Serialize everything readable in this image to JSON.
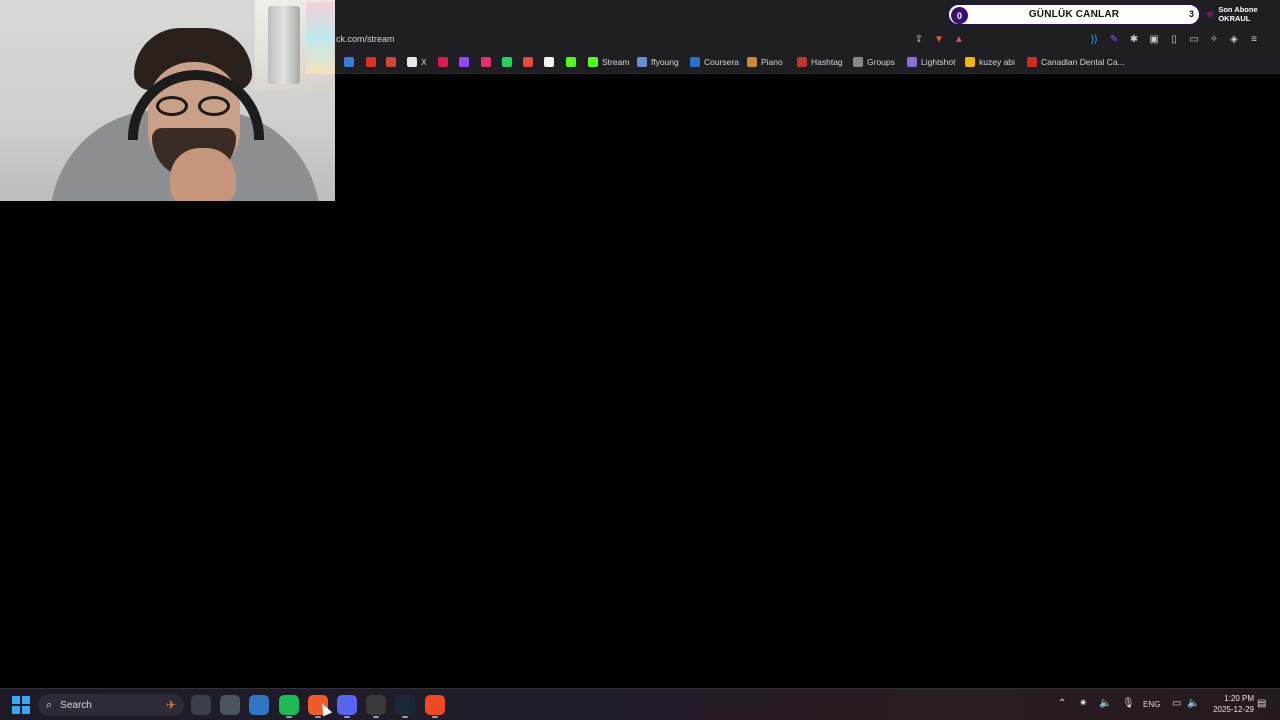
{
  "browser": {
    "url": "ck.com/stream",
    "bookmarks": [
      {
        "label": "",
        "icon": "edge-icon",
        "color": "#3a7bd5"
      },
      {
        "label": "",
        "icon": "youtube-icon",
        "color": "#e52d27"
      },
      {
        "label": "",
        "icon": "gmail-icon",
        "color": "#d44638"
      },
      {
        "label": "X",
        "icon": "x-icon",
        "color": "#e8e8e8"
      },
      {
        "label": "",
        "icon": "opera-icon",
        "color": "#e01a4f"
      },
      {
        "label": "",
        "icon": "twitch-icon",
        "color": "#9146ff"
      },
      {
        "label": "",
        "icon": "instagram-icon",
        "color": "#e1306c"
      },
      {
        "label": "",
        "icon": "whatsapp-icon",
        "color": "#25d366"
      },
      {
        "label": "",
        "icon": "tumblr-icon",
        "color": "#e34c3c"
      },
      {
        "label": "",
        "icon": "amazon-icon",
        "color": "#f2f2f2"
      },
      {
        "label": "",
        "icon": "kick-icon",
        "color": "#53fc18"
      },
      {
        "label": "Stream",
        "icon": "kick-icon",
        "color": "#53fc18"
      },
      {
        "label": "ffyoung",
        "icon": "link-icon",
        "color": "#6a8fd0"
      },
      {
        "label": "Coursera",
        "icon": "coursera-icon",
        "color": "#2a73cc"
      },
      {
        "label": "Piano",
        "icon": "piano-icon",
        "color": "#c98b3c"
      },
      {
        "label": "Hashtag",
        "icon": "hashtag-icon",
        "color": "#c0392b"
      },
      {
        "label": "Groups",
        "icon": "groups-icon",
        "color": "#888888"
      },
      {
        "label": "Lightshot",
        "icon": "feather-icon",
        "color": "#8b6cd9"
      },
      {
        "label": "kuzey abi",
        "icon": "drive-icon",
        "color": "#f4b400"
      },
      {
        "label": "Canadian Dental Ca...",
        "icon": "maple-leaf-icon",
        "color": "#d52b1e"
      }
    ]
  },
  "overlay": {
    "daily_widget": {
      "left_count": "0",
      "title": "GÜNLÜK CANLAR",
      "right_count": "3"
    },
    "last_sub": {
      "title": "Son Abone",
      "name": "OKRAUL"
    }
  },
  "taskbar": {
    "search_label": "Search",
    "apps": [
      {
        "name": "file-explorer-icon",
        "color": "#3b3f48"
      },
      {
        "name": "notepad-icon",
        "color": "#4a5560"
      },
      {
        "name": "photos-icon",
        "color": "#2f77c4"
      },
      {
        "name": "spotify-icon",
        "color": "#1db954"
      },
      {
        "name": "brave-icon",
        "color": "#f15a2b"
      },
      {
        "name": "discord-icon",
        "color": "#5865f2"
      },
      {
        "name": "obs-icon",
        "color": "#3a3a3a"
      },
      {
        "name": "steam-icon",
        "color": "#1b2838"
      },
      {
        "name": "ea-icon",
        "color": "#f04a23"
      }
    ],
    "tray": {
      "language": "ENG"
    },
    "clock": {
      "time": "1:20 PM",
      "date": "2025-12-29"
    }
  }
}
